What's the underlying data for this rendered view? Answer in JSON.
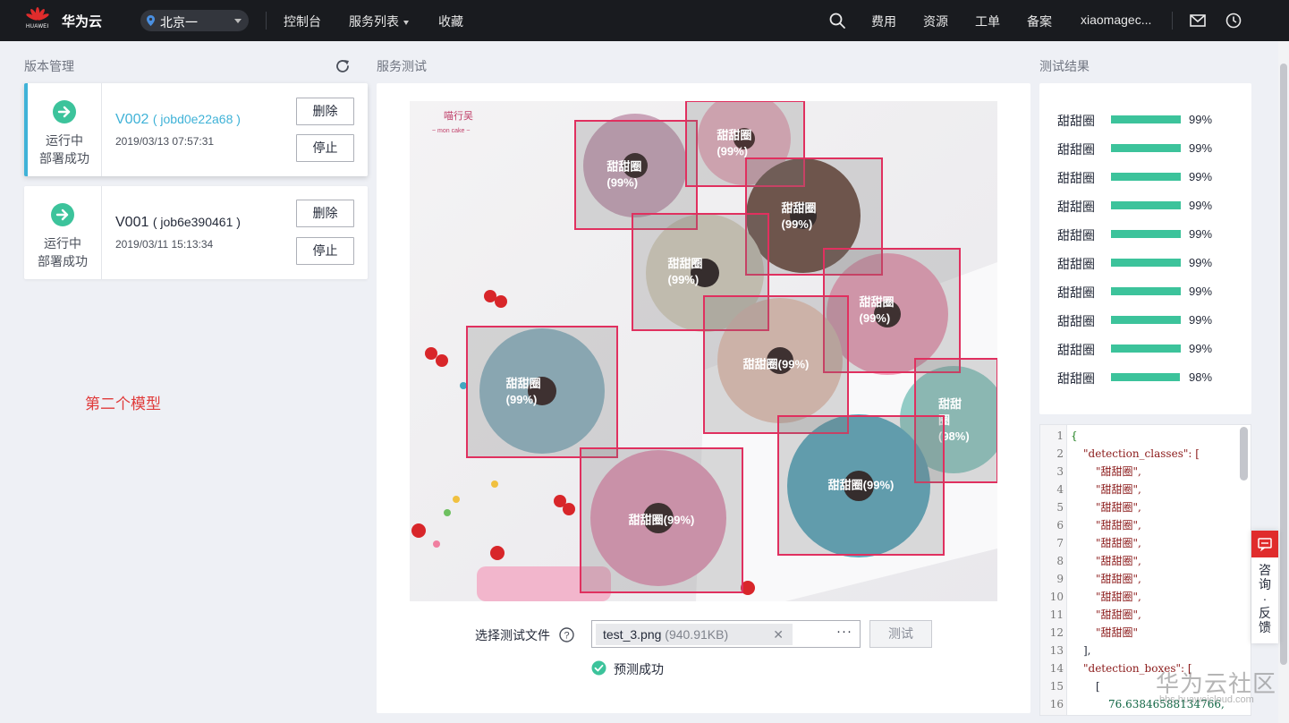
{
  "topbar": {
    "brand": "华为云",
    "logo_text": "HUAWEI",
    "region": "北京一",
    "nav": {
      "console": "控制台",
      "services": "服务列表",
      "favorites": "收藏",
      "fees": "费用",
      "resources": "资源",
      "tickets": "工单",
      "filing": "备案",
      "user": "xiaomagec..."
    }
  },
  "versions": {
    "title": "版本管理",
    "items": [
      {
        "version": "V002",
        "job": "( jobd0e22a68 )",
        "time": "2019/03/13 07:57:31",
        "status1": "运行中",
        "status2": "部署成功",
        "delete": "删除",
        "stop": "停止"
      },
      {
        "version": "V001",
        "job": "( job6e390461 )",
        "time": "2019/03/11 15:13:34",
        "status1": "运行中",
        "status2": "部署成功",
        "delete": "删除",
        "stop": "停止"
      }
    ],
    "note": "第二个模型"
  },
  "service_test": {
    "title": "服务测试",
    "image": {
      "watermark_line1": "喵行吴",
      "watermark_line2": "~ mon cake ~",
      "detections": [
        {
          "label": "甜甜圈\n(99%)"
        },
        {
          "label": "甜甜圈\n(99%)"
        },
        {
          "label": "甜甜圈\n(99%)"
        },
        {
          "label": "甜甜圈\n(99%)"
        },
        {
          "label": "甜甜圈\n(99%)"
        },
        {
          "label": "甜甜圈(99%)"
        },
        {
          "label": "甜甜圈\n(99%)"
        },
        {
          "label": "甜甜\n圈\n(98%)"
        },
        {
          "label": "甜甜圈(99%)"
        },
        {
          "label": "甜甜圈(99%)"
        }
      ]
    },
    "file_label": "选择测试文件",
    "file_name": "test_3.png",
    "file_size": "(940.91KB)",
    "file_remove": "✕",
    "file_more": "···",
    "test_button": "测试",
    "success": "预测成功"
  },
  "results": {
    "title": "测试结果",
    "items": [
      {
        "label": "甜甜圈",
        "pct": "99%",
        "value": 0.99
      },
      {
        "label": "甜甜圈",
        "pct": "99%",
        "value": 0.99
      },
      {
        "label": "甜甜圈",
        "pct": "99%",
        "value": 0.99
      },
      {
        "label": "甜甜圈",
        "pct": "99%",
        "value": 0.99
      },
      {
        "label": "甜甜圈",
        "pct": "99%",
        "value": 0.99
      },
      {
        "label": "甜甜圈",
        "pct": "99%",
        "value": 0.99
      },
      {
        "label": "甜甜圈",
        "pct": "99%",
        "value": 0.99
      },
      {
        "label": "甜甜圈",
        "pct": "99%",
        "value": 0.99
      },
      {
        "label": "甜甜圈",
        "pct": "99%",
        "value": 0.99
      },
      {
        "label": "甜甜圈",
        "pct": "98%",
        "value": 0.98
      }
    ]
  },
  "json_view": {
    "lines": [
      {
        "n": "1",
        "text": "{",
        "kind": "brace"
      },
      {
        "n": "2",
        "text": "\"detection_classes\": [",
        "kind": "key",
        "indent": 1
      },
      {
        "n": "3",
        "text": "\"甜甜圈\",",
        "kind": "str",
        "indent": 2
      },
      {
        "n": "4",
        "text": "\"甜甜圈\",",
        "kind": "str",
        "indent": 2
      },
      {
        "n": "5",
        "text": "\"甜甜圈\",",
        "kind": "str",
        "indent": 2
      },
      {
        "n": "6",
        "text": "\"甜甜圈\",",
        "kind": "str",
        "indent": 2
      },
      {
        "n": "7",
        "text": "\"甜甜圈\",",
        "kind": "str",
        "indent": 2
      },
      {
        "n": "8",
        "text": "\"甜甜圈\",",
        "kind": "str",
        "indent": 2
      },
      {
        "n": "9",
        "text": "\"甜甜圈\",",
        "kind": "str",
        "indent": 2
      },
      {
        "n": "10",
        "text": "\"甜甜圈\",",
        "kind": "str",
        "indent": 2
      },
      {
        "n": "11",
        "text": "\"甜甜圈\",",
        "kind": "str",
        "indent": 2
      },
      {
        "n": "12",
        "text": "\"甜甜圈\"",
        "kind": "str",
        "indent": 2
      },
      {
        "n": "13",
        "text": "],",
        "kind": "punc",
        "indent": 1
      },
      {
        "n": "14",
        "text": "\"detection_boxes\": [",
        "kind": "key",
        "indent": 1
      },
      {
        "n": "15",
        "text": "[",
        "kind": "punc",
        "indent": 2
      },
      {
        "n": "16",
        "text": "76.63846588134766,",
        "kind": "num",
        "indent": 3
      }
    ]
  },
  "consult": {
    "text": "咨询·反馈"
  },
  "watermark": {
    "main": "华为云社区",
    "sub": "bbs.huaweicloud.com"
  },
  "colors": {
    "accent": "#3fb2d7",
    "bar": "#3cc39b",
    "box": "#e0305f",
    "note": "#e03b3b"
  }
}
